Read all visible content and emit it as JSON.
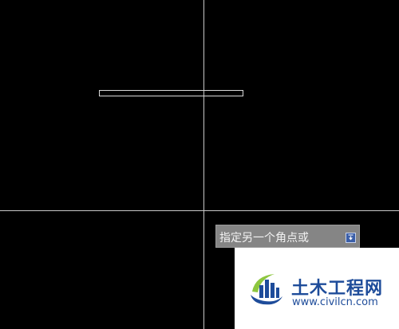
{
  "drawing_area": {
    "background_color": "#000000",
    "crosshair_color": "#c8c8c8"
  },
  "command_tooltip": {
    "prompt": "指定另一个角点或",
    "options_icon": "down-arrow-icon"
  },
  "watermark": {
    "title": "土木工程网",
    "url": "www.civilcn.com",
    "logo_icon": "civilcn-logo",
    "brand_color": "#1e4c9a"
  }
}
